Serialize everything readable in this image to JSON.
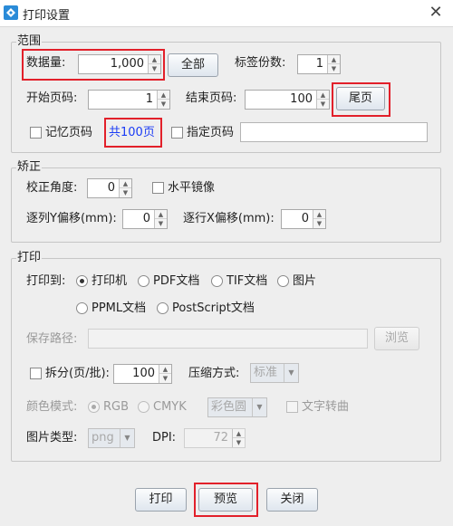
{
  "window": {
    "title": "打印设置",
    "close_glyph": "✕"
  },
  "range": {
    "title": "范围",
    "quantity_label": "数据量:",
    "quantity_value": "1,000",
    "all_button": "全部",
    "copies_label": "标签份数:",
    "copies_value": "1",
    "start_page_label": "开始页码:",
    "start_page_value": "1",
    "end_page_label": "结束页码:",
    "end_page_value": "100",
    "last_page_button": "尾页",
    "remember_page_label": "记忆页码",
    "total_pages_text": "共100页",
    "specify_page_label": "指定页码",
    "specify_page_value": ""
  },
  "correction": {
    "title": "矫正",
    "angle_label": "校正角度:",
    "angle_value": "0",
    "mirror_label": "水平镜像",
    "y_offset_label": "逐列Y偏移(mm):",
    "y_offset_value": "0",
    "x_offset_label": "逐行X偏移(mm):",
    "x_offset_value": "0"
  },
  "print": {
    "title": "打印",
    "print_to_label": "打印到:",
    "options": [
      "打印机",
      "PDF文档",
      "TIF文档",
      "图片",
      "PPML文档",
      "PostScript文档"
    ],
    "selected_option": "打印机",
    "save_path_label": "保存路径:",
    "save_path_value": "",
    "browse_button": "浏览",
    "split_label": "拆分(页/批):",
    "split_value": "100",
    "compression_label": "压缩方式:",
    "compression_value": "标准",
    "color_mode_label": "颜色模式:",
    "color_rgb": "RGB",
    "color_cmyk": "CMYK",
    "color_combo_value": "彩色圆",
    "text_curve_label": "文字转曲",
    "image_type_label": "图片类型:",
    "image_type_value": "png",
    "dpi_label": "DPI:",
    "dpi_value": "72"
  },
  "footer": {
    "print_button": "打印",
    "preview_button": "预览",
    "close_button": "关闭"
  },
  "colors": {
    "highlight": "#e2202a",
    "link": "#1a3cf5",
    "icon_blue": "#2a8bd8"
  }
}
